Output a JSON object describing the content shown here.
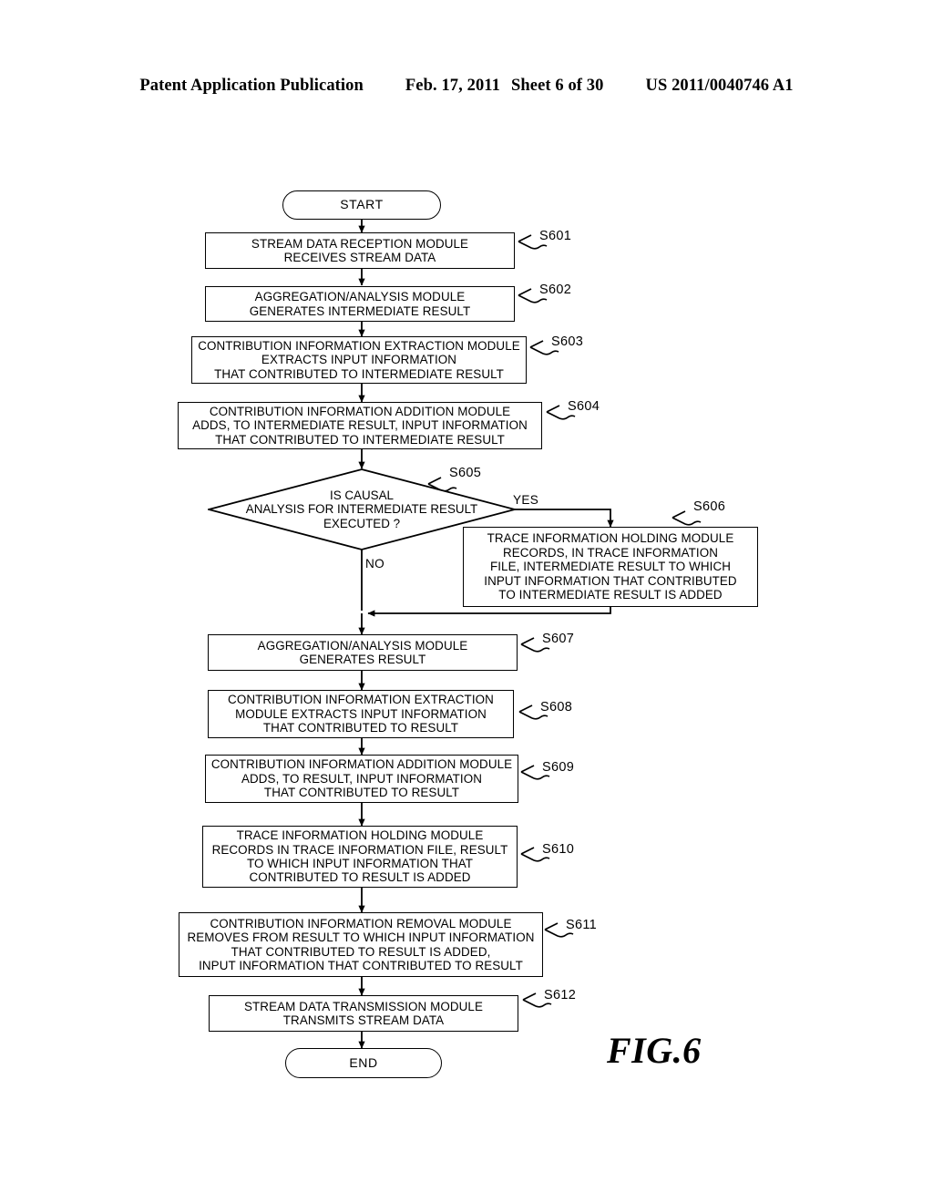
{
  "header": {
    "left": "Patent Application Publication",
    "date": "Feb. 17, 2011",
    "sheet": "Sheet 6 of 30",
    "docnum": "US 2011/0040746 A1"
  },
  "figure": {
    "caption": "FIG.6",
    "start_label": "START",
    "end_label": "END",
    "branch_yes": "YES",
    "branch_no": "NO"
  },
  "steps": [
    {
      "id": "S601",
      "text": "STREAM DATA RECEPTION MODULE\nRECEIVES STREAM DATA"
    },
    {
      "id": "S602",
      "text": "AGGREGATION/ANALYSIS MODULE\nGENERATES INTERMEDIATE RESULT"
    },
    {
      "id": "S603",
      "text": "CONTRIBUTION INFORMATION EXTRACTION MODULE\nEXTRACTS INPUT INFORMATION\nTHAT CONTRIBUTED TO INTERMEDIATE RESULT"
    },
    {
      "id": "S604",
      "text": "CONTRIBUTION INFORMATION ADDITION MODULE\nADDS, TO INTERMEDIATE RESULT, INPUT INFORMATION\nTHAT CONTRIBUTED TO INTERMEDIATE RESULT"
    },
    {
      "id": "S605",
      "text": "IS CAUSAL\nANALYSIS FOR INTERMEDIATE RESULT\nEXECUTED ?"
    },
    {
      "id": "S606",
      "text": "TRACE INFORMATION HOLDING MODULE\nRECORDS, IN TRACE INFORMATION\nFILE, INTERMEDIATE RESULT TO WHICH\nINPUT INFORMATION THAT CONTRIBUTED\nTO INTERMEDIATE RESULT IS ADDED"
    },
    {
      "id": "S607",
      "text": "AGGREGATION/ANALYSIS MODULE\nGENERATES RESULT"
    },
    {
      "id": "S608",
      "text": "CONTRIBUTION INFORMATION EXTRACTION\nMODULE EXTRACTS INPUT INFORMATION\nTHAT CONTRIBUTED TO RESULT"
    },
    {
      "id": "S609",
      "text": "CONTRIBUTION INFORMATION ADDITION MODULE\nADDS, TO RESULT, INPUT INFORMATION\nTHAT CONTRIBUTED TO RESULT"
    },
    {
      "id": "S610",
      "text": "TRACE INFORMATION HOLDING MODULE\nRECORDS IN TRACE INFORMATION FILE, RESULT\nTO WHICH INPUT INFORMATION THAT\nCONTRIBUTED TO RESULT IS ADDED"
    },
    {
      "id": "S611",
      "text": "CONTRIBUTION INFORMATION REMOVAL MODULE\nREMOVES FROM RESULT TO WHICH INPUT INFORMATION\nTHAT CONTRIBUTED TO RESULT IS ADDED,\nINPUT INFORMATION THAT CONTRIBUTED TO RESULT"
    },
    {
      "id": "S612",
      "text": "STREAM DATA TRANSMISSION MODULE\nTRANSMITS STREAM DATA"
    }
  ]
}
